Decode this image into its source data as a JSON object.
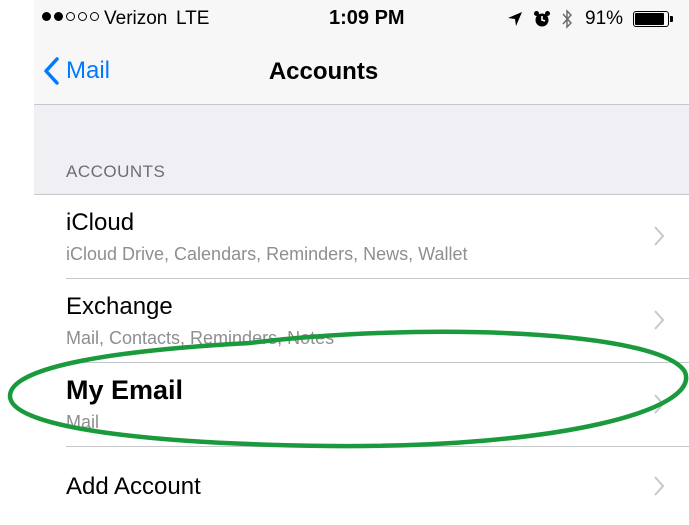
{
  "status_bar": {
    "carrier": "Verizon",
    "network": "LTE",
    "time": "1:09 PM",
    "battery": "91%",
    "battery_level": 0.91,
    "signal_bars_filled": 2,
    "signal_bars_total": 5,
    "icons": [
      "location-arrow-icon",
      "alarm-clock-icon",
      "bluetooth-icon",
      "battery-icon"
    ]
  },
  "nav": {
    "back_label": "Mail",
    "title": "Accounts"
  },
  "section": {
    "header": "ACCOUNTS"
  },
  "accounts": [
    {
      "title": "iCloud",
      "subtitle": "iCloud Drive, Calendars, Reminders, News, Wallet"
    },
    {
      "title": "Exchange",
      "subtitle": "Mail, Contacts, Reminders, Notes"
    },
    {
      "title": "My Email",
      "subtitle": "Mail"
    }
  ],
  "add_account_label": "Add Account",
  "colors": {
    "ios_blue": "#007aff",
    "annotation_green": "#1a9a3c",
    "background_grey": "#efeff4"
  }
}
